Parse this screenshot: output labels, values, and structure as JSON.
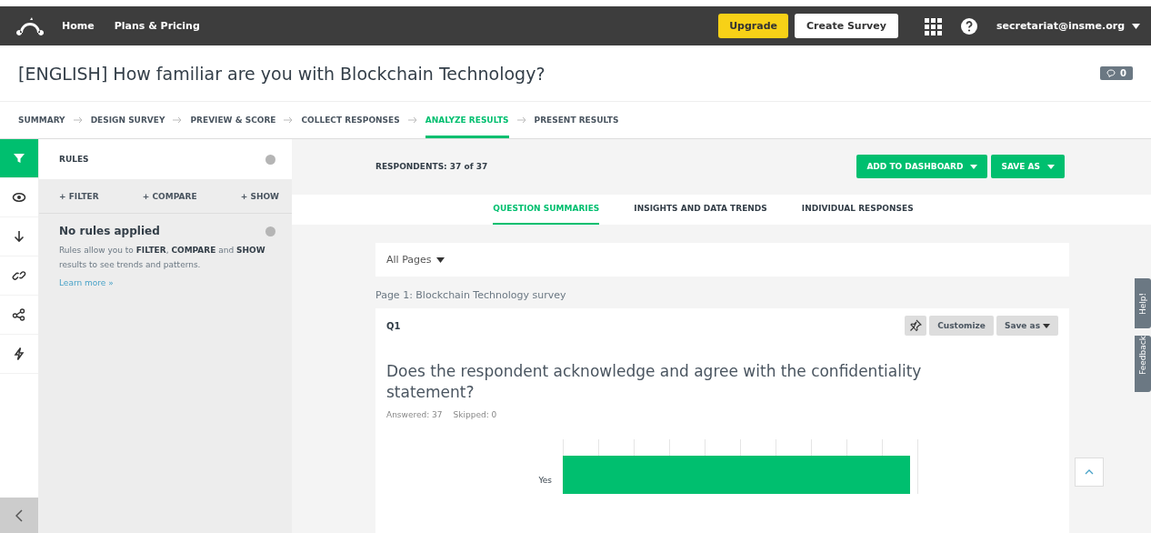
{
  "top_nav": {
    "links": [
      "Home",
      "Plans & Pricing"
    ],
    "upgrade": "Upgrade",
    "create": "Create Survey",
    "account": "secretariat@insme.org"
  },
  "title": "[ENGLISH] How familiar are you with Blockchain Technology?",
  "comments": "0",
  "steps": [
    {
      "label": "SUMMARY",
      "selected": false
    },
    {
      "label": "DESIGN SURVEY",
      "selected": false
    },
    {
      "label": "PREVIEW & SCORE",
      "selected": false
    },
    {
      "label": "COLLECT RESPONSES",
      "selected": false
    },
    {
      "label": "ANALYZE RESULTS",
      "selected": true
    },
    {
      "label": "PRESENT RESULTS",
      "selected": false
    }
  ],
  "side_tools": [
    {
      "kind": "filter",
      "selected": true
    },
    {
      "kind": "eye",
      "selected": false
    },
    {
      "kind": "down",
      "selected": false
    },
    {
      "kind": "link",
      "selected": false
    },
    {
      "kind": "share",
      "selected": false
    },
    {
      "kind": "bolt",
      "selected": false
    }
  ],
  "rules": {
    "title": "RULES",
    "actions": [
      "+ FILTER",
      "+ COMPARE",
      "+ SHOW"
    ],
    "heading": "No rules applied",
    "text": "Rules allow you to **FILTER**, **COMPARE** and **SHOW** results to see trends and patterns.",
    "link": "Learn more »"
  },
  "respondents": "RESPONDENTS: 37 of 37",
  "add_dashboard": "ADD TO DASHBOARD",
  "save_as": "SAVE AS",
  "view_tabs": [
    {
      "label": "QUESTION SUMMARIES",
      "selected": true
    },
    {
      "label": "INSIGHTS AND DATA TRENDS",
      "selected": false
    },
    {
      "label": "INDIVIDUAL RESPONSES",
      "selected": false
    }
  ],
  "page_select": "All Pages",
  "page_label": "Page 1: Blockchain Technology survey",
  "question": {
    "number": "Q1",
    "customize": "Customize",
    "save_as": "Save as",
    "text": "Does the respondent acknowledge and agree with the confidentiality statement?",
    "answered": "Answered: 37",
    "skipped": "Skipped: 0",
    "category": "Yes"
  },
  "side_tabs": [
    "Help!",
    "Feedback"
  ]
}
